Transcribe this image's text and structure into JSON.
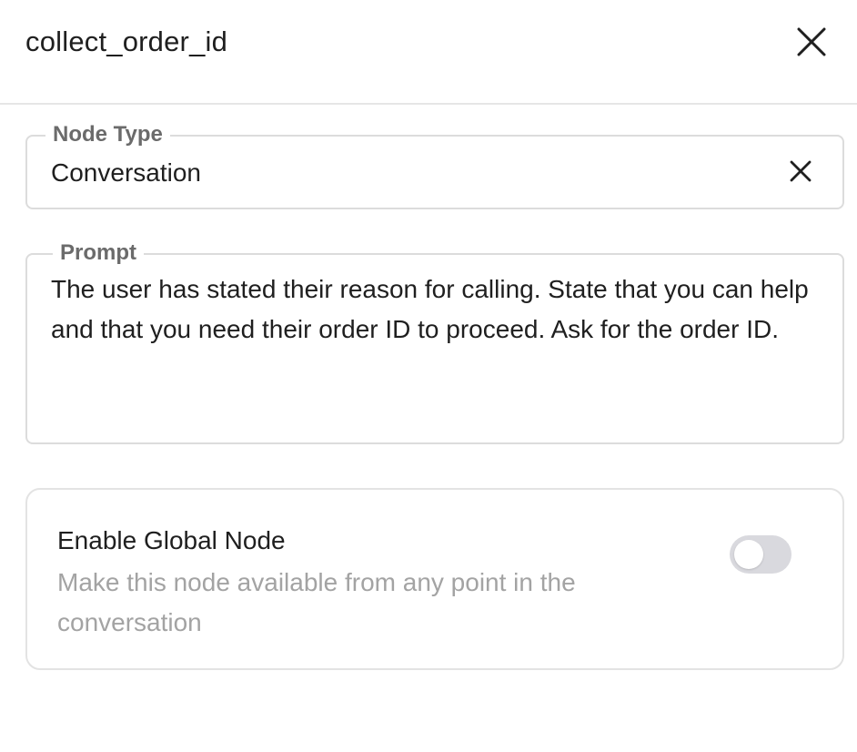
{
  "header": {
    "title": "collect_order_id",
    "close_icon": "close-icon"
  },
  "node_type": {
    "label": "Node Type",
    "value": "Conversation",
    "clear_icon": "close-icon"
  },
  "prompt": {
    "label": "Prompt",
    "value": "The user has stated their reason for calling. State that you can help and that you need their order ID to proceed. Ask for the order ID."
  },
  "global_node": {
    "title": "Enable Global Node",
    "description": "Make this node available from any point in the conversation",
    "enabled": false
  },
  "colors": {
    "text": "#1f1f1f",
    "muted_label": "#6b6b6b",
    "description": "#a3a3a3",
    "border": "#dcdcdc",
    "toggle_off": "#d9d9de"
  }
}
